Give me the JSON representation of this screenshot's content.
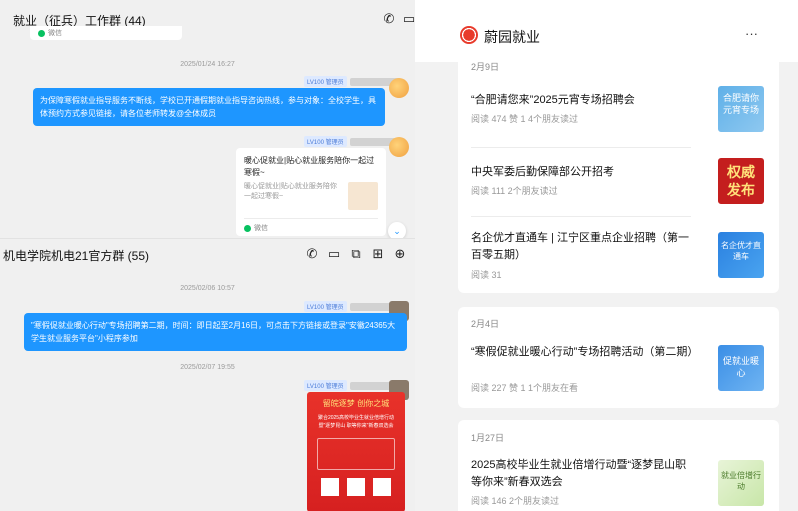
{
  "chat1": {
    "title": "就业（征兵）工作群 (44)",
    "prev_card_source": "微信",
    "time": "2025/01/24 16:27",
    "badge": "LV100 管理员",
    "msg": "为保障寒假就业指导服务不断线，学校已开通假期就业指导咨询热线，参与对象：全校学生，具体预约方式参见链接，请各位老师转发@全体成员",
    "card": {
      "title": "暖心促就业|贴心就业服务陪你一起过寒假~",
      "desc": "暖心促就业|贴心就业服务陪你一起过寒假~",
      "source": "微信"
    },
    "scroll_icon": "⌄"
  },
  "chat2": {
    "title": "机电学院机电21官方群 (55)",
    "time1": "2025/02/06 10:57",
    "badge": "LV100 管理员",
    "msg": "\"寒假促就业暖心行动\"专场招聘第二期，时间：即日起至2月16日，可点击下方链接或登录\"安徽24365大学生就业服务平台\"小程序参加",
    "time2": "2025/02/07 19:55",
    "badge2": "LV100 管理员",
    "poster": {
      "slogan": "留皖逐梦 创你之城",
      "line1": "聚合2025高校毕业生就业倍增行动",
      "line2": "暨\"逐梦昆山 职等你来\"新春双选会"
    }
  },
  "right": {
    "brand": "蔚园就业",
    "more_icon": "···",
    "groups": [
      {
        "date": "2月9日",
        "articles": [
          {
            "title": "“合肥请您来”2025元宵专场招聘会",
            "meta": "阅读 474   赞 1   4个朋友读过",
            "thumb_text": "合肥请你 元宵专场"
          },
          {
            "title": "中央军委后勤保障部公开招考",
            "meta": "阅读 111   2个朋友读过",
            "thumb_text": "权威发布"
          },
          {
            "title": "名企优才直通车 | 江宁区重点企业招聘（第一百零五期）",
            "meta": "阅读 31",
            "thumb_text": "名企优才直通车"
          }
        ]
      },
      {
        "date": "2月4日",
        "articles": [
          {
            "title": "“寒假促就业暖心行动”专场招聘活动（第二期）",
            "meta": "阅读 227   赞 1   1个朋友在看",
            "thumb_text": "促就业暖心"
          }
        ]
      },
      {
        "date": "1月27日",
        "articles": [
          {
            "title": "2025高校毕业生就业倍增行动暨“逐梦昆山职等你来”新春双选会",
            "meta": "阅读 146   2个朋友读过",
            "thumb_text": "就业倍增行动"
          }
        ]
      }
    ]
  }
}
